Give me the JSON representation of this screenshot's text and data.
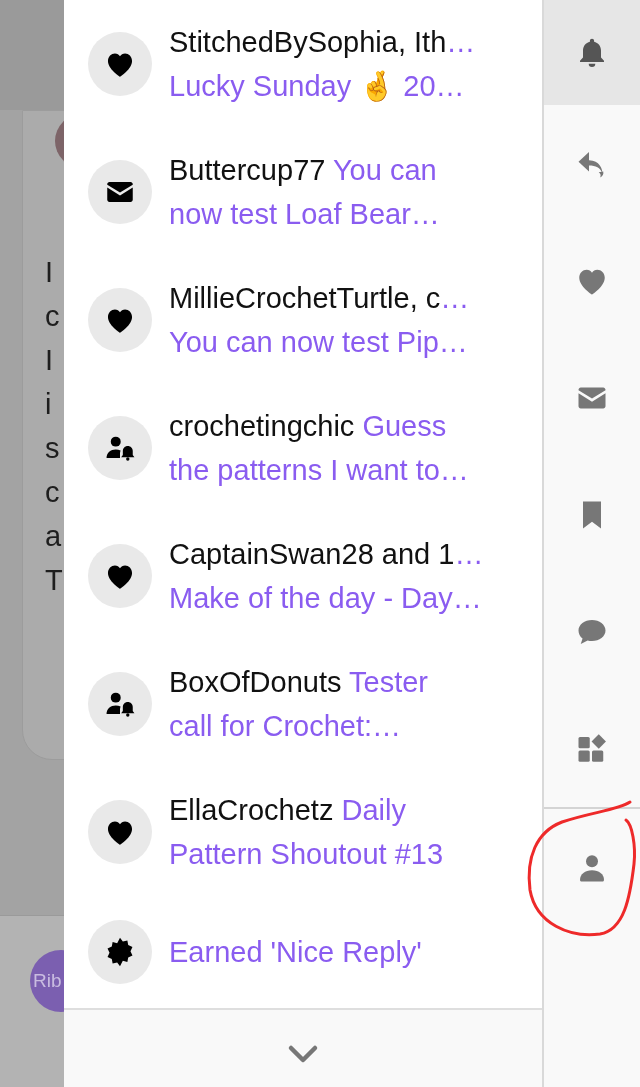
{
  "background_page": {
    "post_text_lines": [
      "I",
      "c",
      "I",
      "i",
      "s",
      "c",
      "a",
      "T"
    ],
    "avatar_label": "Rib"
  },
  "notifications": [
    {
      "kind": "heart",
      "user": "StitchedBySophia, Ith",
      "user_ellipsis": "…",
      "title_lines": [
        "Lucky Sunday 🤞 20…"
      ]
    },
    {
      "kind": "mail",
      "user": "Buttercup77",
      "title_lines": [
        "You can",
        "now test Loaf Bear…"
      ]
    },
    {
      "kind": "heart",
      "user": "MillieCrochetTurtle, c",
      "user_ellipsis": "…",
      "title_lines": [
        "You can now test Pip…"
      ]
    },
    {
      "kind": "user-bell",
      "user": "crochetingchic",
      "title_lines": [
        "Guess",
        "the patterns I want to…"
      ]
    },
    {
      "kind": "heart",
      "user": "CaptainSwan28 and 1",
      "user_ellipsis": "…",
      "title_lines": [
        "Make of the day - Day…"
      ]
    },
    {
      "kind": "user-bell",
      "user": "BoxOfDonuts",
      "title_lines": [
        "Tester",
        "call for Crochet:…"
      ]
    },
    {
      "kind": "heart",
      "user": "EllaCrochetz",
      "title_lines": [
        "Daily",
        "Pattern Shoutout #13"
      ]
    },
    {
      "kind": "badge",
      "title_lines": [
        "Earned 'Nice Reply'"
      ]
    }
  ],
  "sidebar_tabs": [
    {
      "kind": "bell",
      "selected": true
    },
    {
      "kind": "reply",
      "selected": false
    },
    {
      "kind": "heart",
      "selected": false
    },
    {
      "kind": "mail",
      "selected": false
    },
    {
      "kind": "bookmark",
      "selected": false
    },
    {
      "kind": "chat",
      "selected": false
    },
    {
      "kind": "widgets",
      "selected": false
    },
    {
      "kind": "user",
      "selected": false
    }
  ]
}
